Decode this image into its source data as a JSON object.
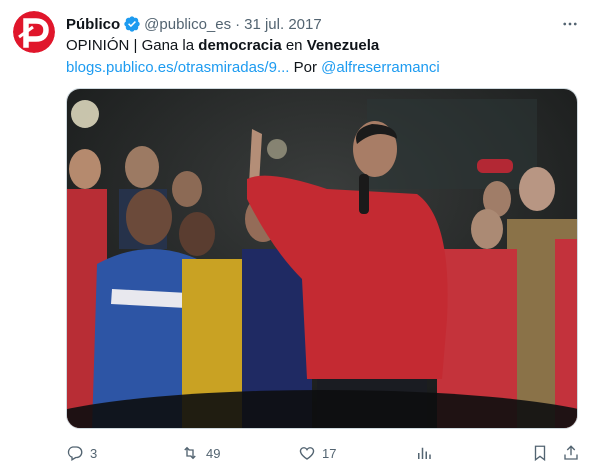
{
  "tweet": {
    "author_name": "Público",
    "handle": "@publico_es",
    "separator": "·",
    "date": "31 jul. 2017",
    "text": {
      "prefix": "OPINIÓN | Gana la ",
      "bold1": "democracia",
      "middle": " en ",
      "bold2": "Venezuela",
      "link_url": "blogs.publico.es/otrasmiradas/9...",
      "por": " Por ",
      "mention": "@alfreserramanci"
    },
    "stats": {
      "replies": "3",
      "retweets": "49",
      "likes": "17"
    }
  },
  "colors": {
    "brand_red": "#e0162b",
    "link_blue": "#1d9bf0",
    "verified_blue": "#1d9bf0",
    "secondary_text": "#536471"
  },
  "icons": [
    "publico-logo-icon",
    "verified-badge-icon",
    "more-icon",
    "reply-icon",
    "retweet-icon",
    "like-icon",
    "views-icon",
    "bookmark-icon",
    "share-icon"
  ]
}
